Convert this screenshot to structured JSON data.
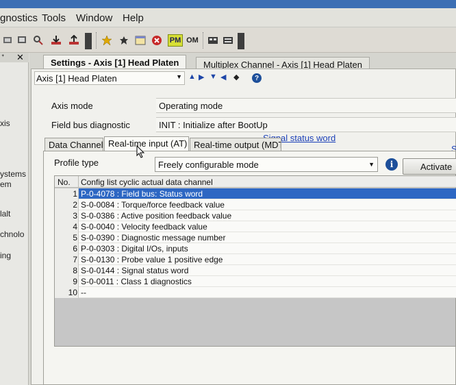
{
  "menu": {
    "items": [
      "gnostics",
      "Tools",
      "Window",
      "Help"
    ]
  },
  "toolbar": {
    "pm_label": "PM",
    "om_label": "OM"
  },
  "left_panel": {
    "items": [
      "xis",
      "ystems",
      "em",
      "lalt",
      "chnolo",
      "ing"
    ]
  },
  "doc_tabs": [
    {
      "label": "Settings - Axis [1] Head Platen",
      "active": true
    },
    {
      "label": "Multiplex Channel - Axis [1] Head Platen",
      "active": false
    }
  ],
  "axis_selector": {
    "value": "Axis [1] Head Platen"
  },
  "fields": [
    {
      "label": "Axis mode",
      "value": "Operating mode"
    },
    {
      "label": "Field bus diagnostic",
      "value": "INIT : Initialize after BootUp"
    }
  ],
  "signal_status_link": "Signal status word",
  "right_edge_link": "S",
  "inner_tabs": [
    {
      "label": "Data Channel",
      "active": false
    },
    {
      "label": "Real-time input (AT)",
      "active": true
    },
    {
      "label": "Real-time output (MDT)",
      "active": false
    }
  ],
  "profile": {
    "label": "Profile type",
    "value": "Freely configurable mode"
  },
  "activate_button": "Activate",
  "grid": {
    "header_no": "No.",
    "header_col": "Config list cyclic actual data channel",
    "rows": [
      {
        "no": "1",
        "text": "P-0-4078 : Field bus: Status word",
        "selected": true
      },
      {
        "no": "2",
        "text": "S-0-0084 : Torque/force feedback value"
      },
      {
        "no": "3",
        "text": "S-0-0386 : Active position feedback value"
      },
      {
        "no": "4",
        "text": "S-0-0040 : Velocity feedback value"
      },
      {
        "no": "5",
        "text": "S-0-0390 : Diagnostic message number"
      },
      {
        "no": "6",
        "text": "P-0-0303 : Digital I/Os, inputs"
      },
      {
        "no": "7",
        "text": "S-0-0130 : Probe value 1 positive edge"
      },
      {
        "no": "8",
        "text": "S-0-0144 : Signal status word"
      },
      {
        "no": "9",
        "text": "S-0-0011 : Class 1 diagnostics"
      },
      {
        "no": "10",
        "text": "--"
      }
    ]
  },
  "colors": {
    "selection": "#2d67c3",
    "link": "#1a3fb8",
    "grid_empty": "#c6c6c6"
  }
}
